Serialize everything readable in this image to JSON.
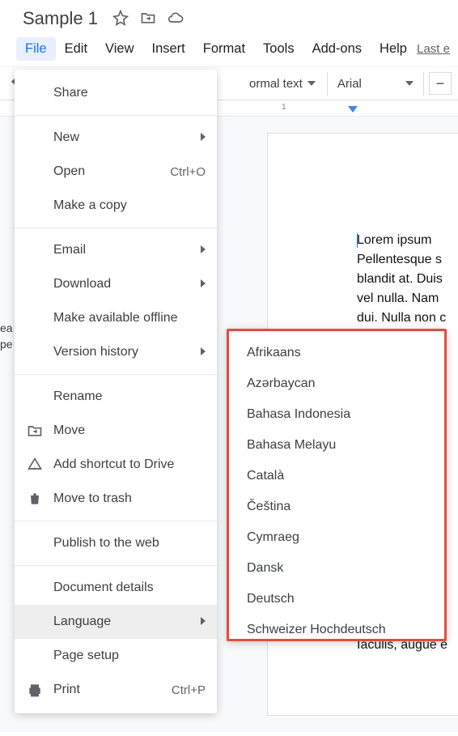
{
  "doc": {
    "title": "Sample 1"
  },
  "menubar": {
    "items": [
      "File",
      "Edit",
      "View",
      "Insert",
      "Format",
      "Tools",
      "Add-ons",
      "Help"
    ],
    "last_edit": "Last e"
  },
  "toolbar": {
    "style_label": "ormal text",
    "font_label": "Arial"
  },
  "ruler": {
    "num1": "1"
  },
  "page": {
    "para1_l1": "Lorem  ipsum ",
    "para1_l2": "Pellentesque  s",
    "para1_l3": "blandit at. Duis",
    "para1_l4": "vel nulla. Nam ",
    "para1_l5": "dui. Nulla non c",
    "trail": "Iaculis, augue e"
  },
  "file_menu": {
    "share": "Share",
    "new": "New",
    "open": "Open",
    "open_shortcut": "Ctrl+O",
    "make_copy": "Make a copy",
    "email": "Email",
    "download": "Download",
    "make_offline": "Make available offline",
    "version_history": "Version history",
    "rename": "Rename",
    "move": "Move",
    "add_shortcut": "Add shortcut to Drive",
    "trash": "Move to trash",
    "publish": "Publish to the web",
    "doc_details": "Document details",
    "language": "Language",
    "page_setup": "Page setup",
    "print": "Print",
    "print_shortcut": "Ctrl+P"
  },
  "languages": [
    "Afrikaans",
    "Azərbaycan",
    "Bahasa Indonesia",
    "Bahasa Melayu",
    "Català",
    "Čeština",
    "Cymraeg",
    "Dansk",
    "Deutsch",
    "Schweizer Hochdeutsch"
  ],
  "bg_text": "ea\npe"
}
